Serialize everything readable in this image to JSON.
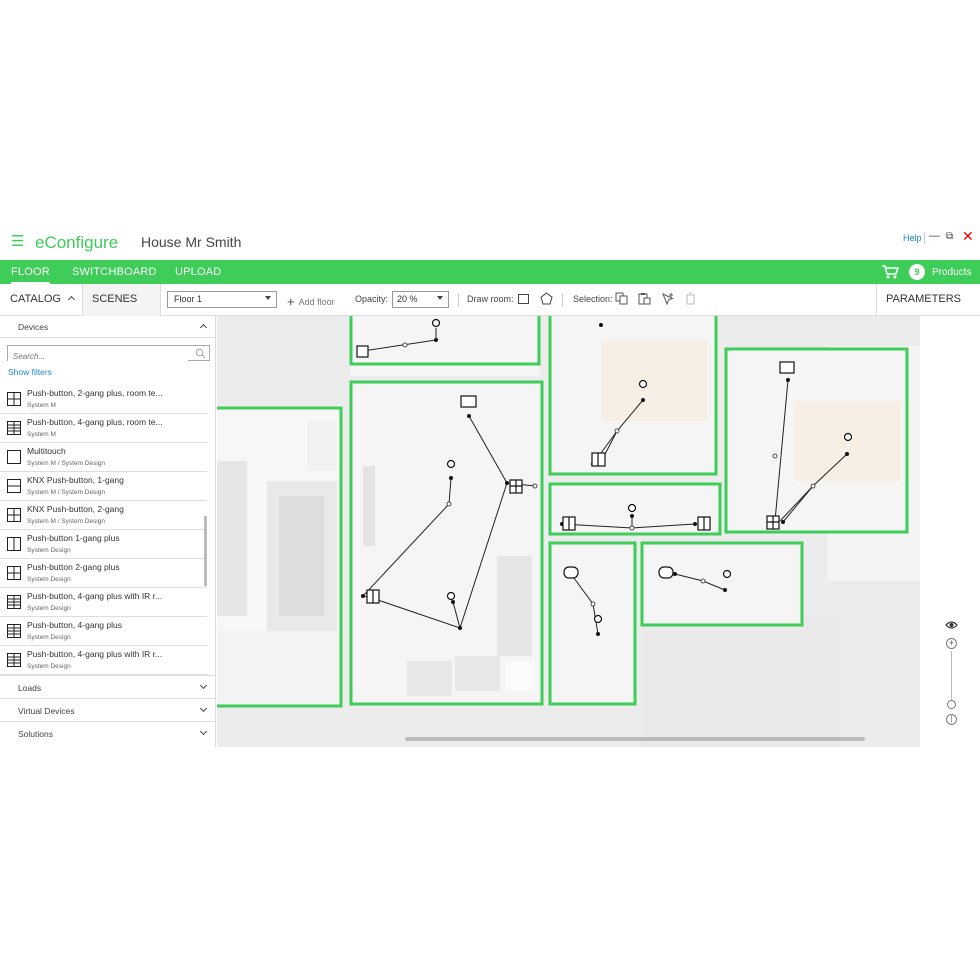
{
  "app": {
    "brand": "eConfigure",
    "project": "House Mr Smith",
    "help": "Help"
  },
  "menu": {
    "floor": "FLOOR",
    "switchboard": "SWITCHBOARD",
    "upload": "UPLOAD",
    "cart_count": "9",
    "products": "Products"
  },
  "toolbar": {
    "catalog": "CATALOG",
    "scenes": "SCENES",
    "floor_select": "Floor 1",
    "add_floor": "Add floor",
    "opacity_label": "Opacity:",
    "opacity_value": "20 %",
    "draw_room": "Draw room:",
    "selection": "Selection:",
    "parameters": "PARAMETERS"
  },
  "catalog": {
    "devices": "Devices",
    "search_placeholder": "Search...",
    "show_filters": "Show filters",
    "items": [
      {
        "name": "Push-button, 2-gang plus, room te...",
        "sub": "System M",
        "icon": "2gang-plus-icon"
      },
      {
        "name": "Push-button, 4-gang plus, room te...",
        "sub": "System M",
        "icon": "4gang-plus-icon"
      },
      {
        "name": "Multitouch",
        "sub": "System M / System Design",
        "icon": "multitouch-icon"
      },
      {
        "name": "KNX Push-button, 1-gang",
        "sub": "System M / System Design",
        "icon": "1gang-icon"
      },
      {
        "name": "KNX Push-button, 2-gang",
        "sub": "System M / System Design",
        "icon": "2gang-icon"
      },
      {
        "name": "Push-button 1-gang plus",
        "sub": "System Design",
        "icon": "1gang-plus-icon"
      },
      {
        "name": "Push-button 2-gang plus",
        "sub": "System Design",
        "icon": "2gang-plus-icon"
      },
      {
        "name": "Push-button, 4-gang plus with IR r...",
        "sub": "System Design",
        "icon": "4gang-ir-icon"
      },
      {
        "name": "Push-button, 4-gang plus",
        "sub": "System Design",
        "icon": "4gang-plus-icon"
      },
      {
        "name": "Push-button, 4-gang plus with IR r...",
        "sub": "System Design",
        "icon": "4gang-ir-icon"
      }
    ],
    "categories": [
      "Loads",
      "Virtual Devices",
      "Solutions"
    ]
  },
  "colors": {
    "accent": "#3dcd58",
    "link": "#1f86c7",
    "close": "#e30000"
  }
}
